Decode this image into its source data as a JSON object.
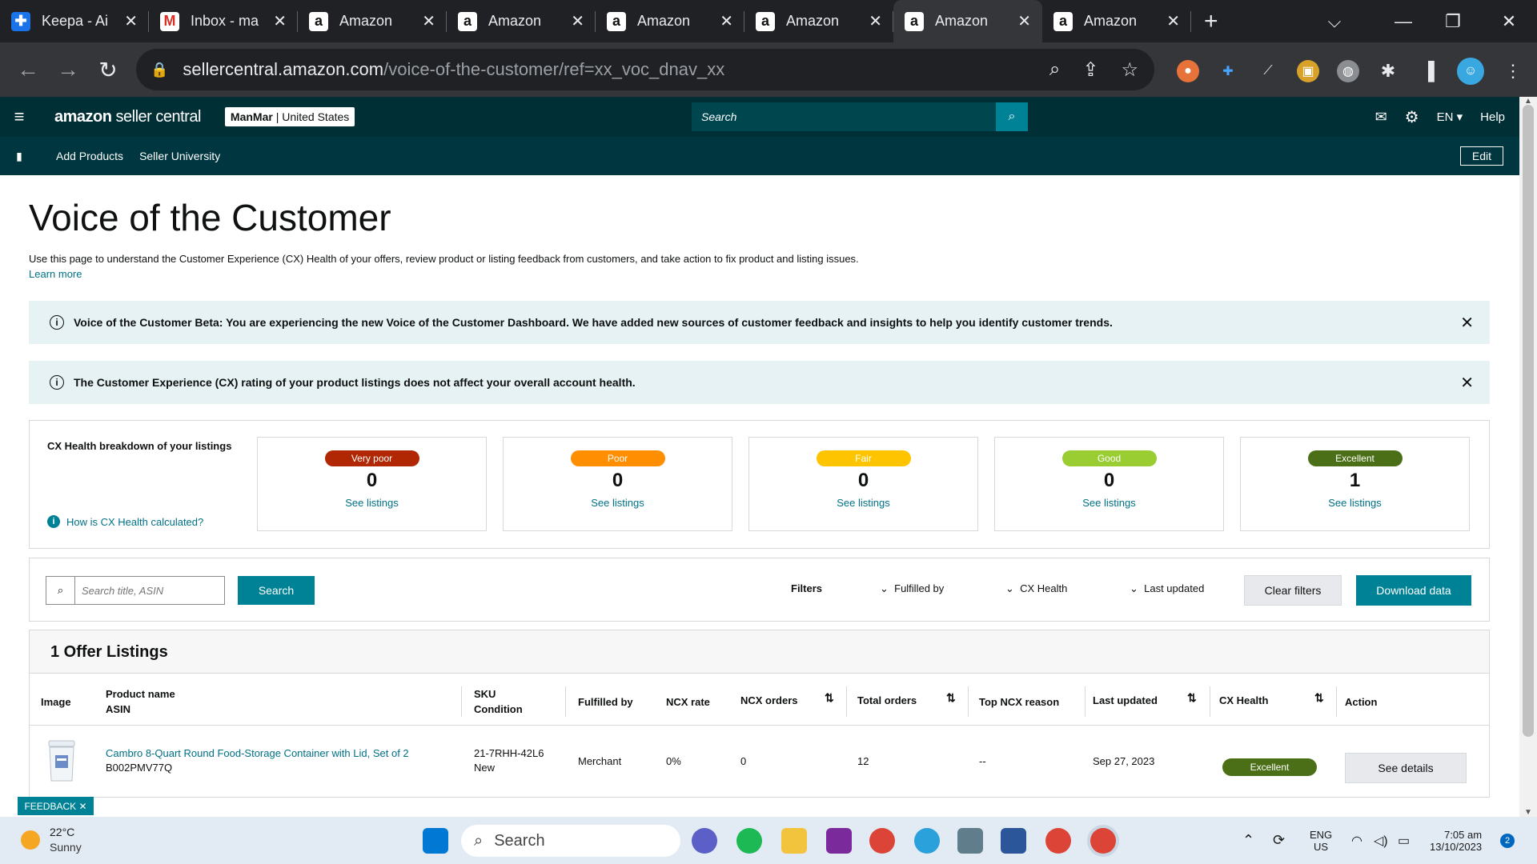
{
  "browser": {
    "tabs": [
      {
        "title": "Keepa - Ai",
        "icon": "keepa-icon",
        "active": false
      },
      {
        "title": "Inbox - ma",
        "icon": "gmail-icon",
        "active": false
      },
      {
        "title": "Amazon",
        "icon": "amazon-icon",
        "active": false
      },
      {
        "title": "Amazon",
        "icon": "amazon-icon",
        "active": false
      },
      {
        "title": "Amazon",
        "icon": "amazon-icon",
        "active": false
      },
      {
        "title": "Amazon",
        "icon": "amazon-icon",
        "active": false
      },
      {
        "title": "Amazon",
        "icon": "amazon-icon",
        "active": true
      },
      {
        "title": "Amazon",
        "icon": "amazon-icon",
        "active": false
      }
    ],
    "url_domain": "sellercentral.amazon.com",
    "url_path": "/voice-of-the-customer/ref=xx_voc_dnav_xx"
  },
  "header": {
    "logo_bold": "amazon",
    "logo_rest": " seller central",
    "account_name": "ManMar",
    "account_region": " | United States",
    "search_placeholder": "Search",
    "language": "EN",
    "help": "Help"
  },
  "subnav": {
    "links": [
      "Add Products",
      "Seller University"
    ],
    "edit": "Edit"
  },
  "page": {
    "title": "Voice of the Customer",
    "intro": "Use this page to understand the Customer Experience (CX) Health of your offers, review product or listing feedback from customers, and take action to fix product and listing issues.",
    "learn_more": "Learn more",
    "banners": [
      "Voice of the Customer Beta: You are experiencing the new Voice of the Customer Dashboard. We have added new sources of customer feedback and insights to help you identify customer trends.",
      "The Customer Experience (CX) rating of your product listings does not affect your overall account health."
    ],
    "cx_title": "CX Health breakdown of your listings",
    "cx_how": "How is CX Health calculated?",
    "cx_cards": [
      {
        "label": "Very poor",
        "count": "0",
        "link": "See listings",
        "color": "#b12704",
        "text_color": "#ffffff"
      },
      {
        "label": "Poor",
        "count": "0",
        "link": "See listings",
        "color": "#ff8f00",
        "text_color": "#ffffff"
      },
      {
        "label": "Fair",
        "count": "0",
        "link": "See listings",
        "color": "#ffc400",
        "text_color": "#ffffff"
      },
      {
        "label": "Good",
        "count": "0",
        "link": "See listings",
        "color": "#9acd32",
        "text_color": "#ffffff"
      },
      {
        "label": "Excellent",
        "count": "1",
        "link": "See listings",
        "color": "#4b6f16",
        "text_color": "#ffffff"
      }
    ],
    "filters": {
      "search_placeholder": "Search title, ASIN",
      "search_button": "Search",
      "label": "Filters",
      "fulfilled_by": "Fulfilled by",
      "cx_health": "CX Health",
      "last_updated": "Last updated",
      "clear": "Clear filters",
      "download": "Download data"
    },
    "listings": {
      "heading": "1 Offer Listings",
      "columns": {
        "image": "Image",
        "product_name": "Product name",
        "asin": "ASIN",
        "sku": "SKU",
        "condition": "Condition",
        "fulfilled_by": "Fulfilled by",
        "ncx_rate": "NCX rate",
        "ncx_orders": "NCX orders",
        "total_orders": "Total orders",
        "top_ncx_reason": "Top NCX reason",
        "last_updated": "Last updated",
        "cx_health": "CX Health",
        "action": "Action"
      },
      "rows": [
        {
          "product_name": "Cambro 8-Quart Round Food-Storage Container with Lid, Set of 2",
          "asin": "B002PMV77Q",
          "sku": "21-7RHH-42L6",
          "condition": "New",
          "fulfilled_by": "Merchant",
          "ncx_rate": "0%",
          "ncx_orders": "0",
          "total_orders": "12",
          "top_ncx_reason": "--",
          "last_updated": "Sep 27, 2023",
          "cx_health": "Excellent",
          "action": "See details"
        }
      ]
    },
    "feedback": "FEEDBACK"
  },
  "taskbar": {
    "temperature": "22°C",
    "weather": "Sunny",
    "search": "Search",
    "lang_top": "ENG",
    "lang_bottom": "US",
    "time": "7:05 am",
    "date": "13/10/2023",
    "notifications": "2"
  }
}
